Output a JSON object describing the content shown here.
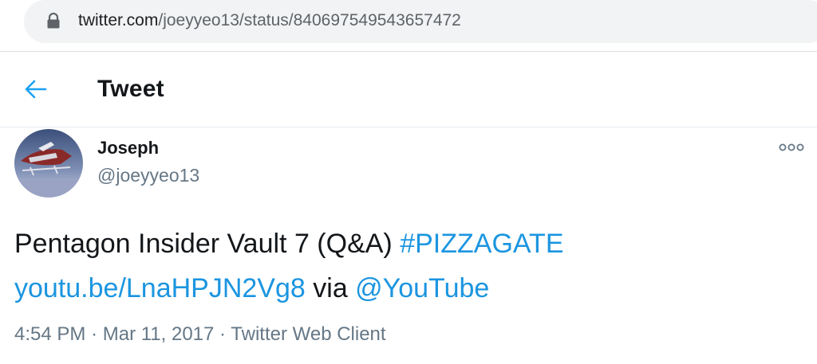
{
  "browser": {
    "url_domain": "twitter.com",
    "url_path": "/joeyyeo13/status/840697549543657472"
  },
  "header": {
    "title": "Tweet"
  },
  "tweet": {
    "author_name": "Joseph",
    "author_handle": "@joeyyeo13",
    "text_part1": "Pentagon Insider Vault 7 (Q&A) ",
    "hashtag": "#PIZZAGATE",
    "link": "youtu.be/LnaHPJN2Vg8",
    "text_via": " via ",
    "mention": "@YouTube",
    "time": "4:54 PM",
    "separator": "·",
    "date": "Mar 11, 2017",
    "client": "Twitter Web Client"
  },
  "icons": {
    "lock": "lock-icon",
    "back": "back-arrow-icon",
    "more": "more-options-icon"
  },
  "colors": {
    "link": "#1b95e0",
    "text": "#14171a",
    "secondary": "#657786"
  }
}
